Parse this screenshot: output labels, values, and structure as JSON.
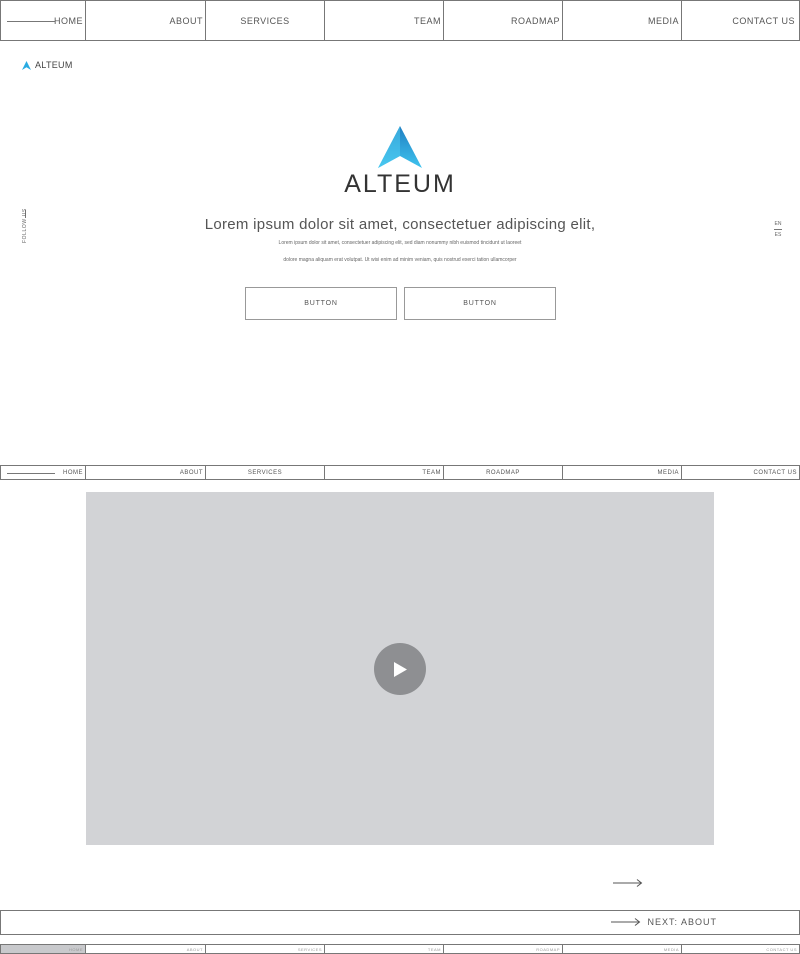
{
  "nav": {
    "items": [
      "HOME",
      "ABOUT",
      "SERVICES",
      "TEAM",
      "ROADMAP",
      "MEDIA",
      "CONTACT US"
    ]
  },
  "brand": {
    "name": "ALTEUM",
    "logo_color": "#29abe2"
  },
  "social": {
    "follow_label": "FOLLOW US"
  },
  "language": {
    "current": "EN",
    "alternate": "ES"
  },
  "hero": {
    "headline": "Lorem ipsum dolor sit amet, consectetuer adipiscing elit,",
    "subtext_line1": "Lorem ipsum dolor sit amet, consectetuer adipiscing elit, sed diam nonummy nibh euismod tincidunt ut laoreet",
    "subtext_line2": "dolore magna aliquam erat volutpat.  Ut wisi enim ad minim veniam, quis nostrud exerci tation ullamcorper",
    "buttons": [
      "BUTTON",
      "BUTTON"
    ]
  },
  "video": {
    "placeholder_color": "#d2d3d6",
    "icon": "play-icon"
  },
  "next": {
    "label": "NEXT:  ABOUT"
  }
}
